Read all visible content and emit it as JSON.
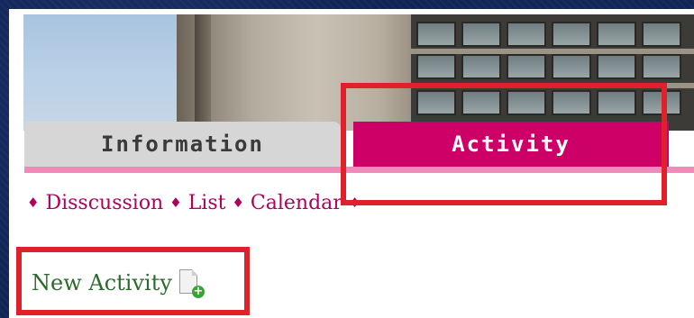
{
  "tabs": [
    {
      "label": "Information",
      "active": false
    },
    {
      "label": "Activity",
      "active": true
    }
  ],
  "subnav": {
    "separator": "♦",
    "items": [
      "Disscussion",
      "List",
      "Calendar"
    ]
  },
  "new_activity": {
    "label": "New Activity",
    "icon": "new-document-add-icon"
  },
  "colors": {
    "active_tab": "#cc0066",
    "inactive_tab": "#d6d6d6",
    "pink_rule": "#f08ab8",
    "link": "#b0005a",
    "new_activity_text": "#2a6b2a",
    "highlight": "#e0202a"
  }
}
